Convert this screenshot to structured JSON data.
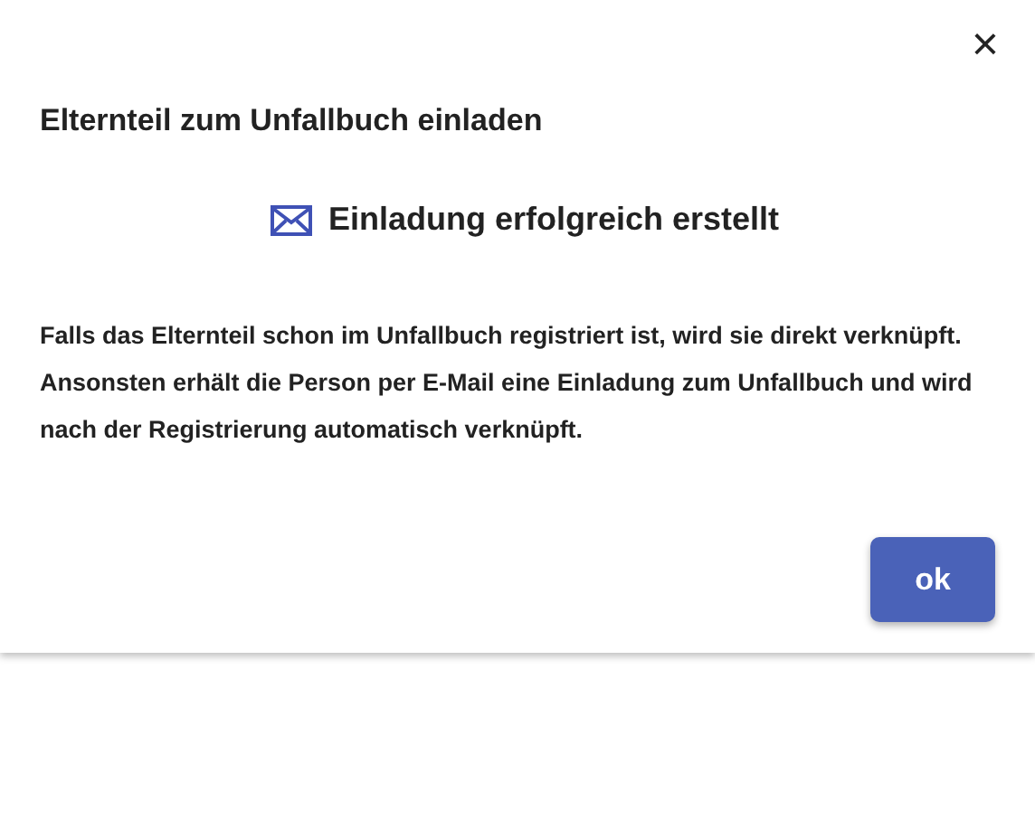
{
  "dialog": {
    "close": "×",
    "title": "Elternteil zum Unfallbuch einladen",
    "status": "Einladung erfolgreich erstellt",
    "message": "Falls das Elternteil schon im Unfallbuch registriert ist, wird sie direkt verknüpft. Ansonsten erhält die Person per E-Mail eine Einladung zum Unfallbuch und wird nach der Registrierung automatisch verknüpft.",
    "buttons": [
      "ok"
    ]
  }
}
